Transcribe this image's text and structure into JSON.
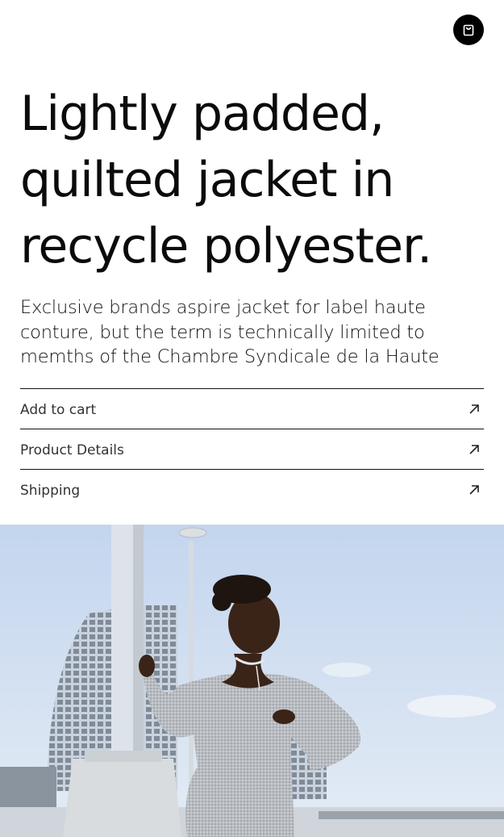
{
  "header": {
    "cart_icon": "shopping-bag-icon"
  },
  "product": {
    "headline": "Lightly padded, quilted jacket in recycle polyester.",
    "description": "Exclusive brands aspire jacket for label haute conture, but the term is technically limited to memths of the Chambre Syndicale de la Haute"
  },
  "menu": {
    "items": [
      {
        "label": "Add to cart",
        "icon": "arrow-up-right-icon"
      },
      {
        "label": "Product Details",
        "icon": "arrow-up-right-icon"
      },
      {
        "label": "Shipping",
        "icon": "arrow-up-right-icon"
      }
    ]
  },
  "hero": {
    "image": "woman-in-grey-knit-dress-photo",
    "sky_color": "#c9d9ee",
    "dress_color": "#b9bcc1"
  }
}
